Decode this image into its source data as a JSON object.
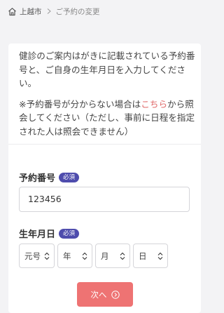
{
  "breadcrumb": {
    "home": "上越市",
    "current": "ご予約の変更"
  },
  "intro": {
    "line1": "健診のご案内はがきに記載されている予約番号と、ご自身の生年月日を入力してください。",
    "note_before": "※予約番号が分からない場合は",
    "note_link": "こちら",
    "note_after": "から照会してください（ただし、事前に日程を指定された人は照会できません）"
  },
  "form": {
    "reservation_label": "予約番号",
    "required_badge": "必須",
    "reservation_value": "123456",
    "dob_label": "生年月日",
    "dob_required_badge": "必須",
    "era": "元号",
    "year": "年",
    "month": "月",
    "day": "日"
  },
  "next_button": "次へ",
  "colors": {
    "accent": "#ee7373",
    "badge": "#4e4cad",
    "link": "#e06a6a",
    "background": "#f3f3f5"
  }
}
